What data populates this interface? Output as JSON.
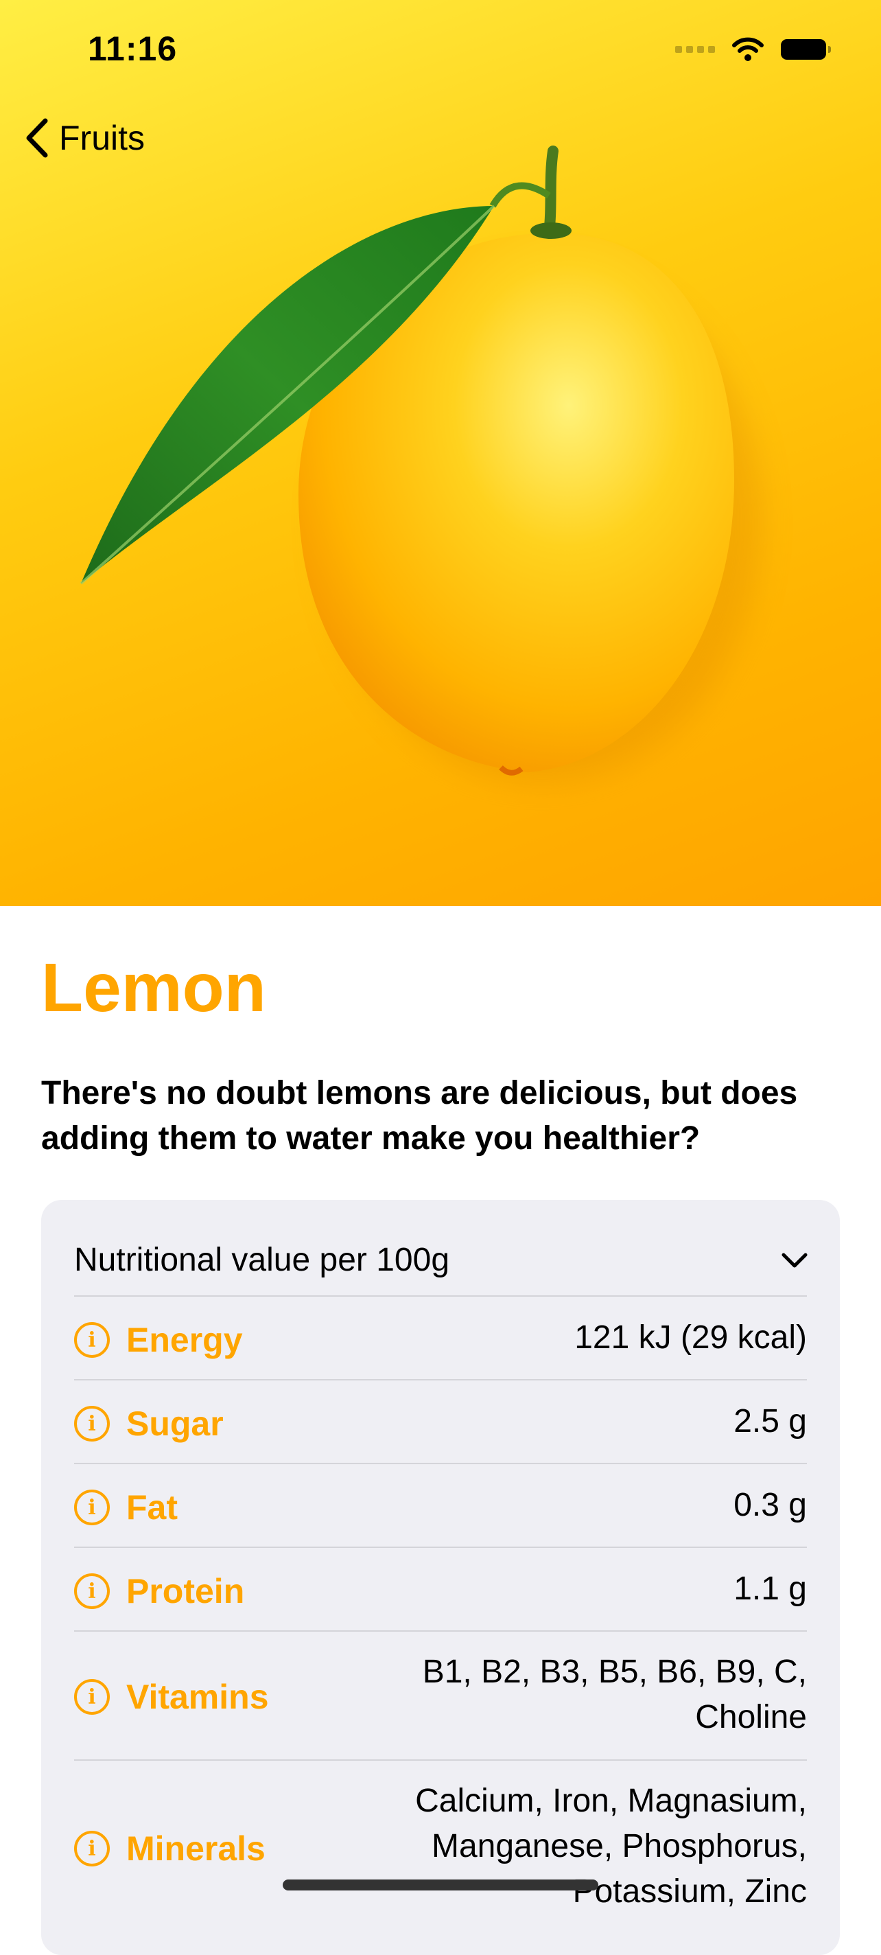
{
  "status_bar": {
    "time": "11:16"
  },
  "nav": {
    "back_label": "Fruits"
  },
  "hero": {
    "image": "lemon-with-leaf",
    "background_color": "#ffc107"
  },
  "fruit": {
    "name": "Lemon",
    "description": "There's no doubt lemons are delicious, but does adding them to water make you healthier?",
    "accent_color": "#ffa500"
  },
  "nutrition": {
    "header": "Nutritional value per 100g",
    "rows": [
      {
        "label": "Energy",
        "value": "121 kJ (29 kcal)"
      },
      {
        "label": "Sugar",
        "value": "2.5 g"
      },
      {
        "label": "Fat",
        "value": "0.3 g"
      },
      {
        "label": "Protein",
        "value": "1.1 g"
      },
      {
        "label": "Vitamins",
        "value_lines": [
          "B1, B2, B3, B5, B6, B9, C,",
          "Choline"
        ]
      },
      {
        "label": "Minerals",
        "value_lines": [
          "Calcium, Iron, Magnasium,",
          "Manganese, Phosphorus,",
          "Potassium, Zinc"
        ]
      }
    ]
  }
}
